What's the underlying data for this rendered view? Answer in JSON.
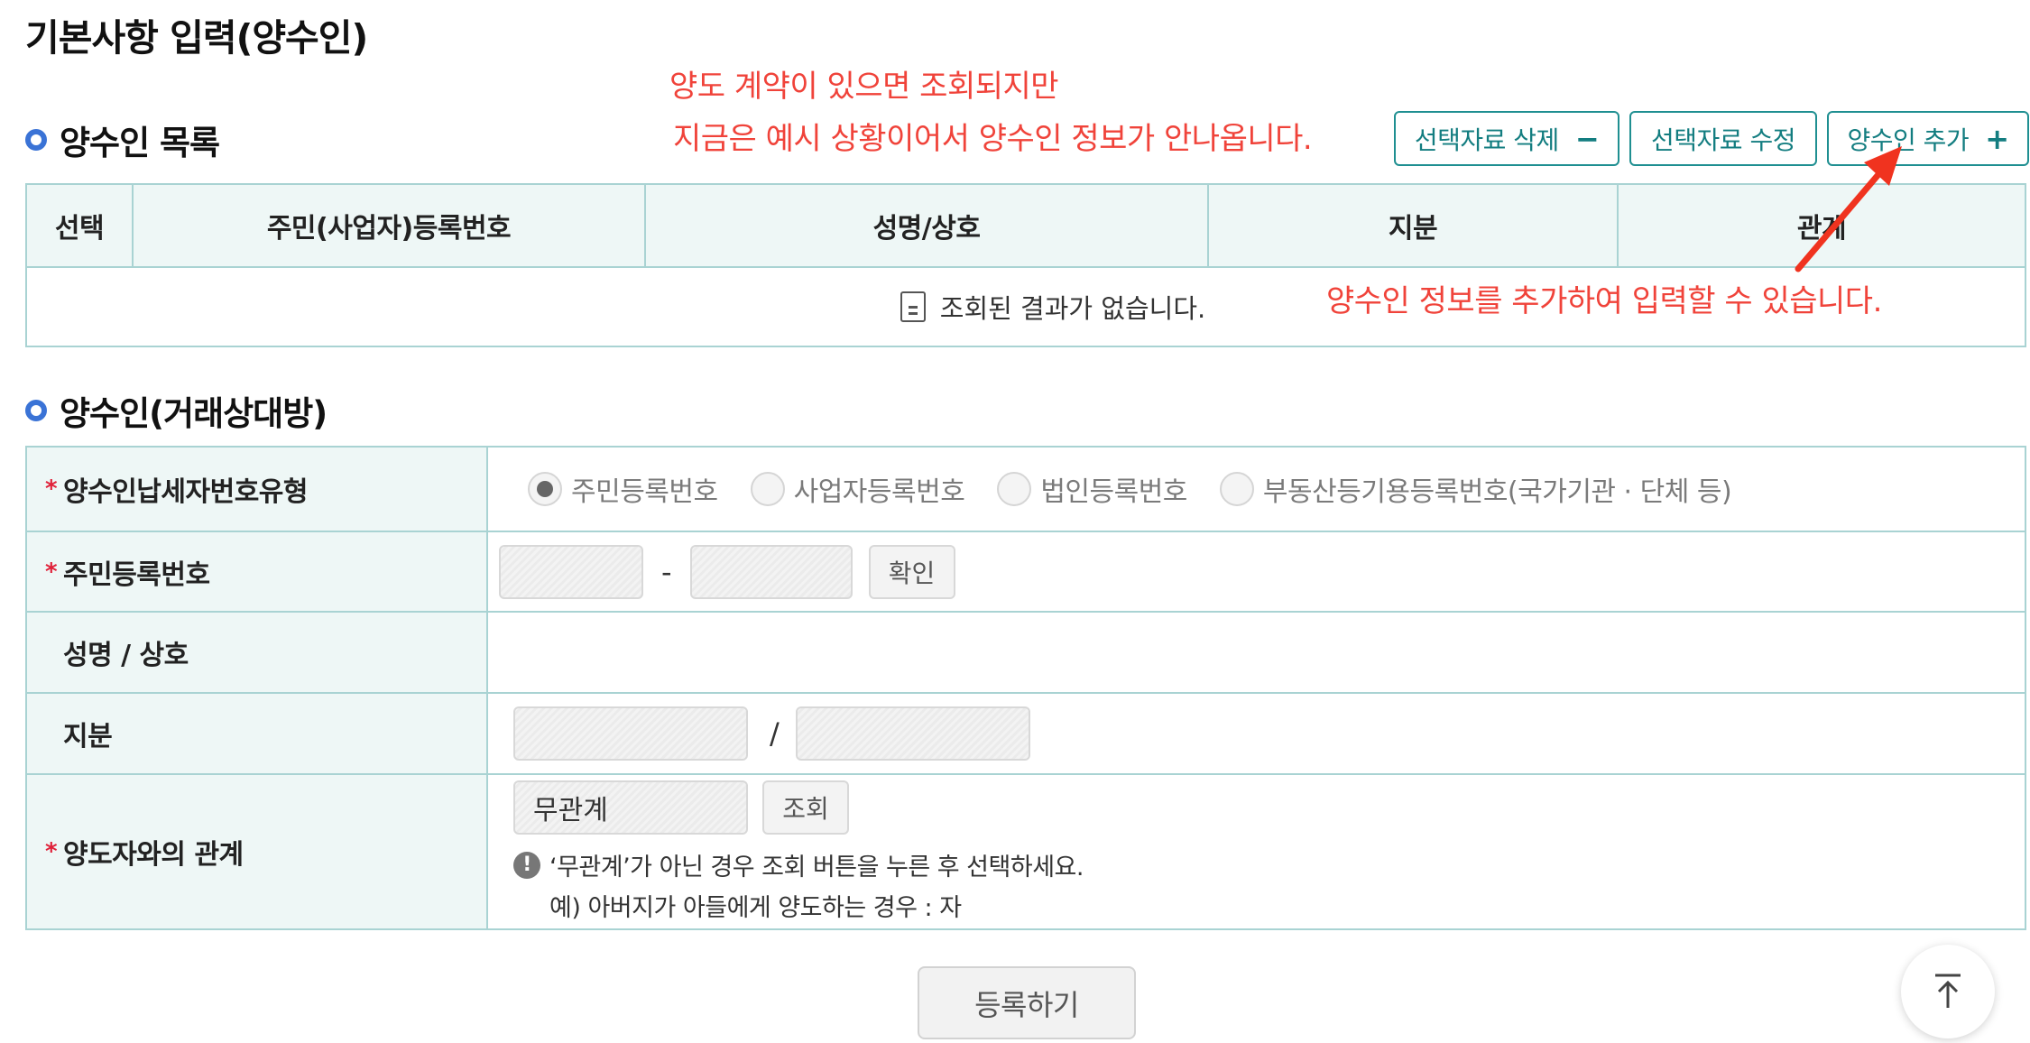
{
  "page": {
    "title": "기본사항 입력(양수인)"
  },
  "annotations": {
    "note_line1": "양도 계약이 있으면 조회되지만",
    "note_line2": "지금은 예시 상황이어서 양수인 정보가 안나옵니다.",
    "note_add": "양수인 정보를 추가하여 입력할 수 있습니다.",
    "color": "#f0433a"
  },
  "list_section": {
    "title": "양수인 목록",
    "buttons": {
      "delete_label": "선택자료 삭제",
      "delete_symbol": "−",
      "modify_label": "선택자료 수정",
      "add_label": "양수인 추가",
      "add_symbol": "+"
    },
    "columns": [
      "선택",
      "주민(사업자)등록번호",
      "성명/상호",
      "지분",
      "관계"
    ],
    "empty_text": "조회된 결과가 없습니다."
  },
  "form_section": {
    "title": "양수인(거래상대방)",
    "rows": {
      "type": {
        "label": "양수인납세자번호유형",
        "options": [
          "주민등록번호",
          "사업자등록번호",
          "법인등록번호",
          "부동산등기용등록번호(국가기관 · 단체 등)"
        ],
        "selected": "주민등록번호"
      },
      "resident": {
        "label": "주민등록번호",
        "separator": "-",
        "confirm_label": "확인",
        "front_value": "",
        "back_value": ""
      },
      "name": {
        "label": "성명 / 상호",
        "value": ""
      },
      "share": {
        "label": "지분",
        "separator": "/",
        "numerator": "",
        "denominator": ""
      },
      "relation": {
        "label": "양도자와의 관계",
        "value": "무관계",
        "lookup_label": "조회",
        "info_line1": "‘무관계’가 아닌 경우 조회 버튼을 누른 후 선택하세요.",
        "info_line2": "예) 아버지가 아들에게 양도하는 경우 : 자"
      }
    }
  },
  "submit_label": "등록하기",
  "colors": {
    "accent": "#1f8f91",
    "header_bg": "#eef7f6",
    "border": "#a9d3d3",
    "required": "#e0223a",
    "bullet": "#3a73d6"
  }
}
